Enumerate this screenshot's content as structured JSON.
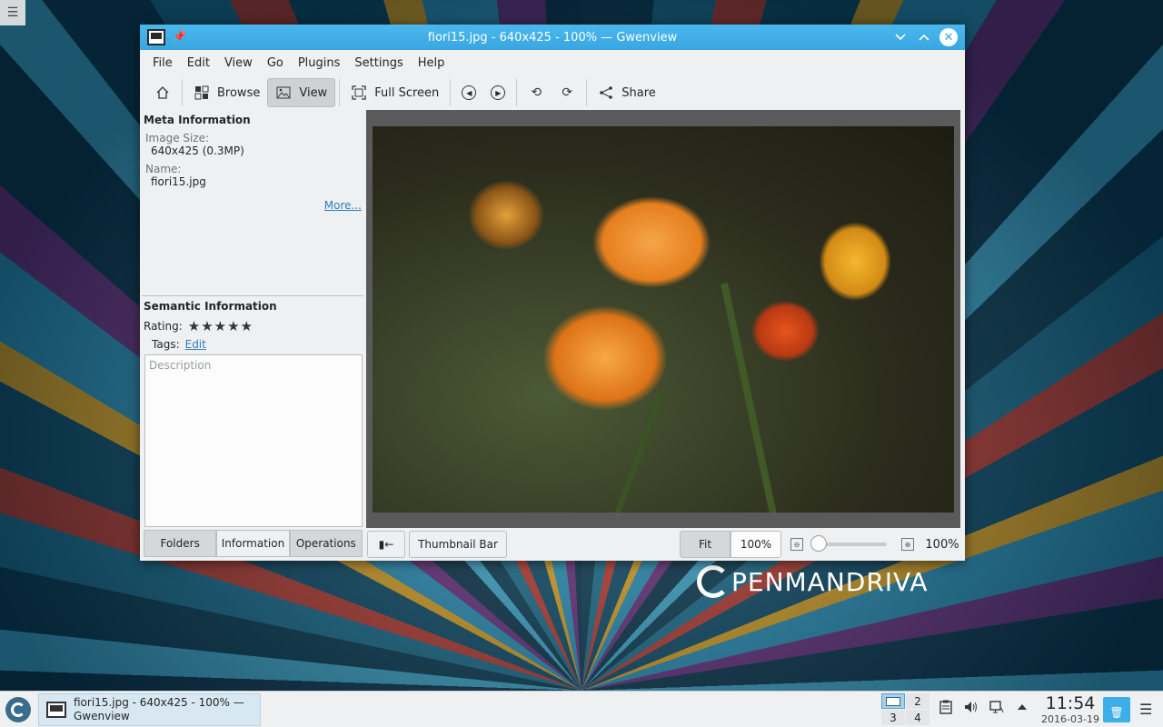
{
  "desktop": {
    "menu_icon": "hamburger-icon",
    "logo_text": "PENMANDRIVA"
  },
  "window": {
    "title": "fiori15.jpg - 640x425 - 100% — Gwenview",
    "buttons": [
      "minimize",
      "maximize",
      "close"
    ]
  },
  "menubar": [
    "File",
    "Edit",
    "View",
    "Go",
    "Plugins",
    "Settings",
    "Help"
  ],
  "toolbar": {
    "browse": "Browse",
    "view": "View",
    "fullscreen": "Full Screen",
    "share": "Share"
  },
  "sidebar": {
    "meta_title": "Meta Information",
    "image_size_label": "Image Size:",
    "image_size_value": "640x425 (0.3MP)",
    "name_label": "Name:",
    "name_value": "fiori15.jpg",
    "more_link": "More...",
    "semantic_title": "Semantic Information",
    "rating_label": "Rating:",
    "rating_stars": 5,
    "tags_label": "Tags:",
    "tags_edit": "Edit",
    "description_placeholder": "Description",
    "tabs": [
      "Folders",
      "Information",
      "Operations"
    ],
    "active_tab": "Information"
  },
  "bottombar": {
    "thumbnail_bar": "Thumbnail Bar",
    "toggle_sidebar_label": "▮←",
    "fit": "Fit",
    "zoom_input": "100%",
    "zoom_level": "100%"
  },
  "taskbar": {
    "task_title": "fiori15.jpg - 640x425 - 100% — Gwenview",
    "pager": [
      "1",
      "2",
      "3",
      "4"
    ],
    "clock_time": "11:54",
    "clock_date": "2016-03-19"
  }
}
